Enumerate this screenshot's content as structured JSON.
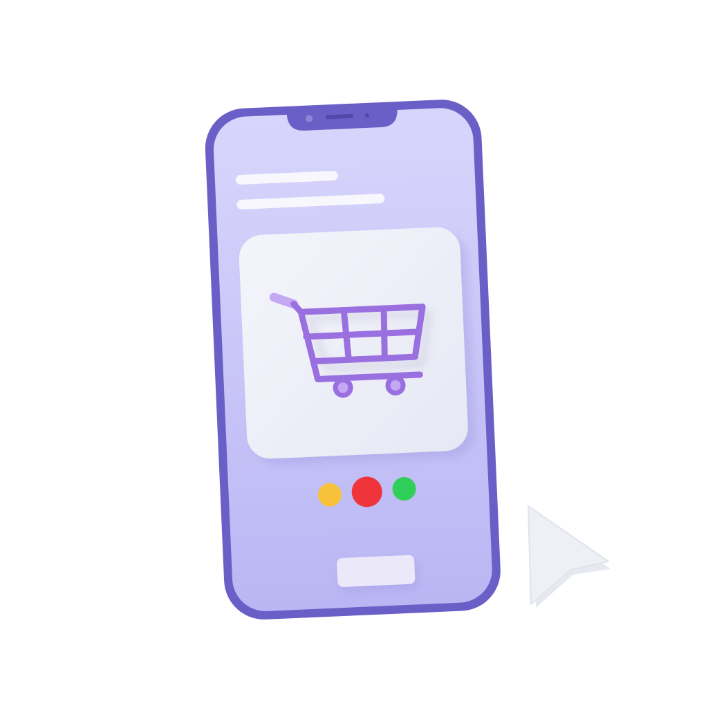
{
  "phone": {
    "frame_color": "#6a5fc6",
    "screen_color_top": "#d6d3fb",
    "screen_color_bottom": "#bcb8f4",
    "notch_camera_color": "#8d86d8"
  },
  "screen": {
    "text_placeholder_lines": 2,
    "product_card": {
      "icon": "shopping-cart-icon",
      "background_color": "#eef0f8",
      "icon_color": "#9a6fe0"
    },
    "color_options": [
      {
        "name": "yellow",
        "color": "#f7c23a"
      },
      {
        "name": "red",
        "color": "#f0343c"
      },
      {
        "name": "green",
        "color": "#2fcf5a"
      }
    ],
    "action_button": {
      "label": "",
      "color": "#ebe8fa"
    }
  },
  "cursor": {
    "icon": "pointer-cursor-icon",
    "color": "#eef0f6"
  }
}
